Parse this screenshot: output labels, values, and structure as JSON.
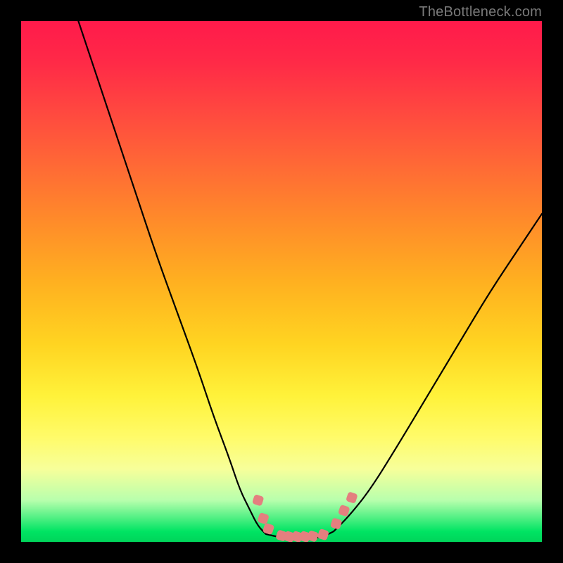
{
  "attribution": "TheBottleneck.com",
  "colors": {
    "gradient_top": "#ff1a4b",
    "gradient_mid": "#ffd421",
    "gradient_bottom": "#00d45a",
    "curve": "#000000",
    "marker": "#e47f7f",
    "page_bg": "#000000",
    "attribution_text": "#7a7a7a"
  },
  "chart_data": {
    "type": "line",
    "title": "",
    "xlabel": "",
    "ylabel": "",
    "xlim": [
      0,
      100
    ],
    "ylim": [
      0,
      100
    ],
    "grid": false,
    "annotations": [],
    "series": [
      {
        "name": "left-curve",
        "x": [
          11,
          14,
          18,
          22,
          26,
          30,
          34,
          37,
          40,
          42,
          44,
          45.5,
          47
        ],
        "y": [
          100,
          91,
          79,
          67,
          55,
          44,
          33,
          24,
          16,
          10,
          6,
          3,
          1.5
        ]
      },
      {
        "name": "valley-floor",
        "x": [
          47,
          50,
          53,
          56,
          58,
          60
        ],
        "y": [
          1.5,
          0.8,
          0.6,
          0.7,
          1.0,
          2.0
        ]
      },
      {
        "name": "right-curve",
        "x": [
          60,
          63,
          67,
          72,
          78,
          84,
          90,
          96,
          100
        ],
        "y": [
          2.0,
          5,
          10,
          18,
          28,
          38,
          48,
          57,
          63
        ]
      }
    ],
    "markers": [
      {
        "x": 45.5,
        "y": 8.0
      },
      {
        "x": 46.5,
        "y": 4.5
      },
      {
        "x": 47.5,
        "y": 2.5
      },
      {
        "x": 50.0,
        "y": 1.2
      },
      {
        "x": 51.5,
        "y": 1.0
      },
      {
        "x": 53.0,
        "y": 1.0
      },
      {
        "x": 54.5,
        "y": 1.0
      },
      {
        "x": 56.0,
        "y": 1.1
      },
      {
        "x": 58.0,
        "y": 1.4
      },
      {
        "x": 60.5,
        "y": 3.5
      },
      {
        "x": 62.0,
        "y": 6.0
      },
      {
        "x": 63.5,
        "y": 8.5
      }
    ]
  }
}
